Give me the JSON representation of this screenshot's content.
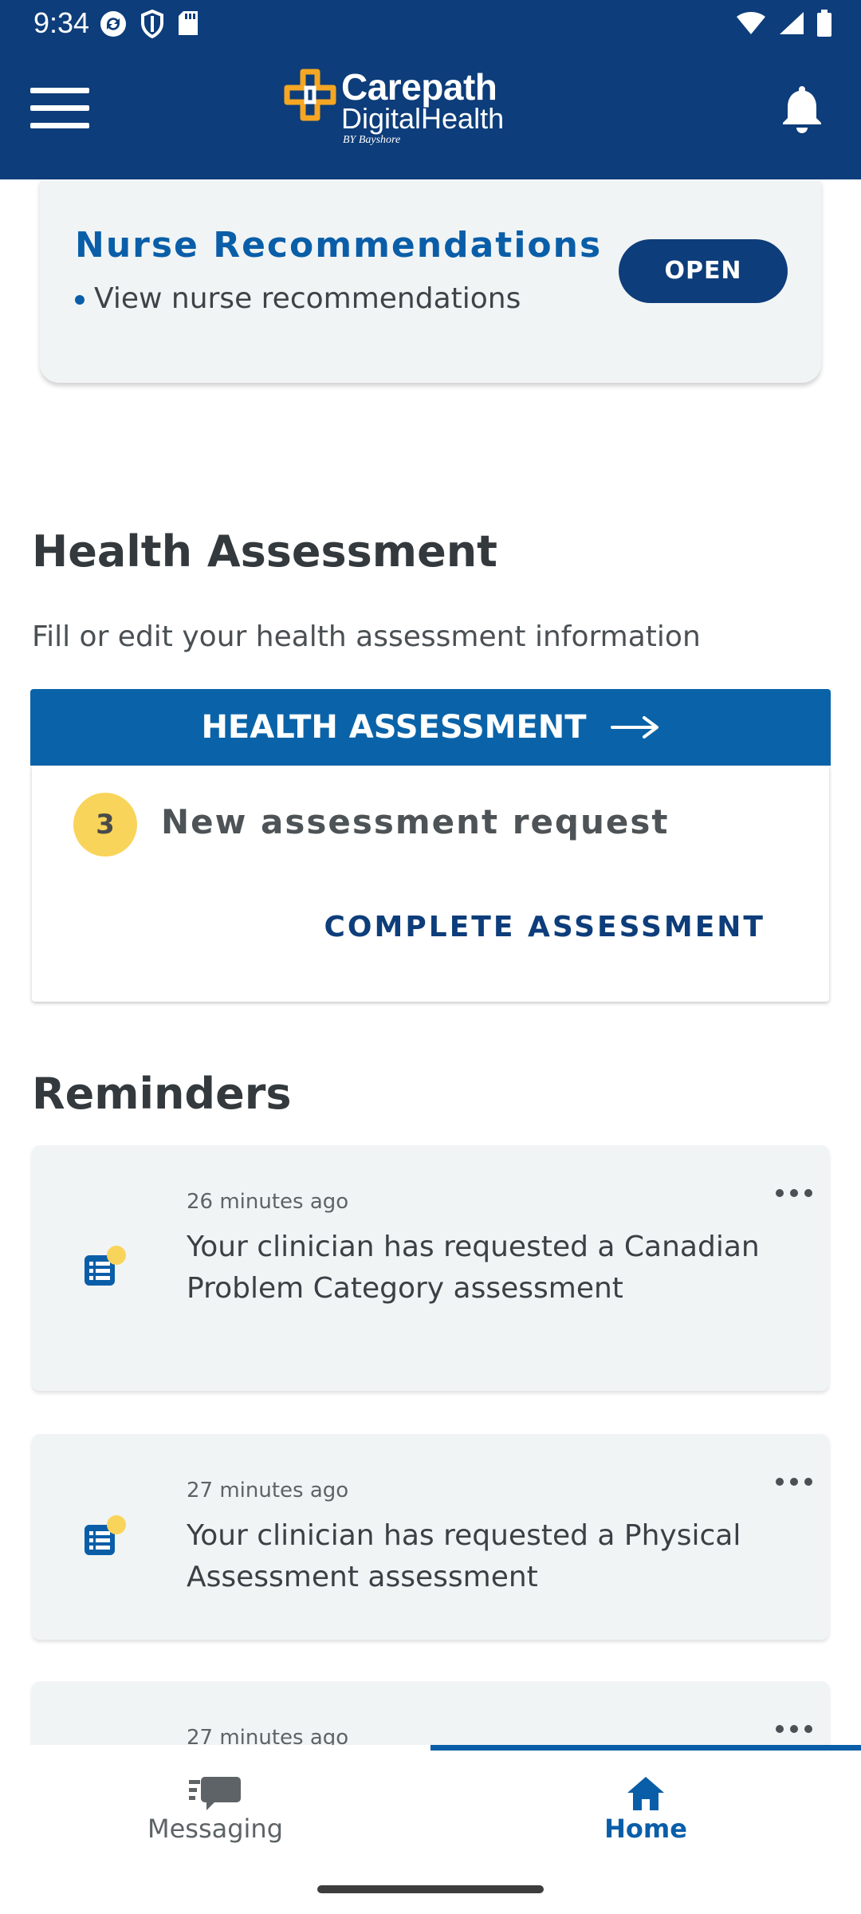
{
  "status_bar": {
    "time": "9:34"
  },
  "header": {
    "brand_line1": "Carepath",
    "brand_line2": "DigitalHealth",
    "brand_line3": "BY Bayshore",
    "brand_color": "#0d3d7a",
    "accent_orange": "#f5a623"
  },
  "nurse_card": {
    "title": "Nurse Recommendations",
    "subtitle": "View nurse recommendations",
    "button": "OPEN"
  },
  "health_assessment": {
    "title": "Health Assessment",
    "description": "Fill or edit your health assessment information",
    "button": "HEALTH ASSESSMENT",
    "badge_count": "3",
    "request_text": "New assessment request",
    "complete_link": "COMPLETE ASSESSMENT"
  },
  "reminders": {
    "title": "Reminders",
    "items": [
      {
        "time": "26 minutes ago",
        "message": "Your clinician has requested a Canadian Problem Category assessment"
      },
      {
        "time": "27 minutes ago",
        "message": "Your clinician has requested a Physical Assessment assessment"
      },
      {
        "time": "27 minutes ago",
        "message": ""
      }
    ]
  },
  "bottom_nav": {
    "items": [
      {
        "label": "Messaging",
        "icon": "chat-icon",
        "active": false
      },
      {
        "label": "Home",
        "icon": "home-icon",
        "active": true
      }
    ]
  }
}
